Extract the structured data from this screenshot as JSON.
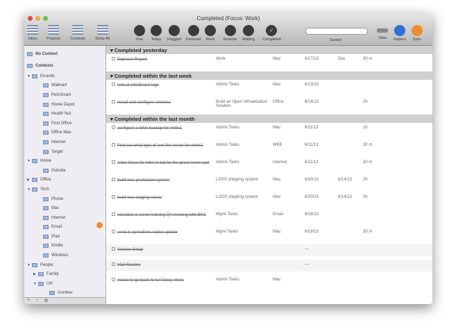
{
  "window": {
    "title": "Completed (Focus: Work)"
  },
  "toolbar": {
    "left": [
      "Inbox",
      "Projects",
      "Contexts",
      "Show All"
    ],
    "perspectives": [
      "Due",
      "Today",
      "Flagged",
      "Forecast",
      "Work",
      "Errands",
      "Waiting",
      "Completed"
    ],
    "search_label": "Search",
    "right": [
      "View",
      "Inspect",
      "Sync"
    ]
  },
  "sidebar": {
    "top": [
      "No Context",
      "Contexts"
    ],
    "items": [
      {
        "label": "Errands",
        "lvl": 0,
        "tri": "▼"
      },
      {
        "label": "Walmart",
        "lvl": 1
      },
      {
        "label": "PetsSmart",
        "lvl": 1
      },
      {
        "label": "Home Depot",
        "lvl": 1
      },
      {
        "label": "Health Nut",
        "lvl": 1
      },
      {
        "label": "Post Office",
        "lvl": 1
      },
      {
        "label": "Office Max",
        "lvl": 1
      },
      {
        "label": "Internet",
        "lvl": 1
      },
      {
        "label": "Target",
        "lvl": 1
      },
      {
        "label": "Home",
        "lvl": 0,
        "tri": "▼"
      },
      {
        "label": "Outside",
        "lvl": 1
      },
      {
        "label": "Office",
        "lvl": 0,
        "tri": "▶"
      },
      {
        "label": "Tech",
        "lvl": 0,
        "tri": "▼"
      },
      {
        "label": "Phone",
        "lvl": 1
      },
      {
        "label": "Mac",
        "lvl": 1
      },
      {
        "label": "Internet",
        "lvl": 1
      },
      {
        "label": "Email",
        "lvl": 1
      },
      {
        "label": "iPad",
        "lvl": 1
      },
      {
        "label": "Kindle",
        "lvl": 1
      },
      {
        "label": "Windows",
        "lvl": 1
      },
      {
        "label": "People",
        "lvl": 0,
        "tri": "▼"
      },
      {
        "label": "Family",
        "lvl": 1,
        "tri": "▶"
      },
      {
        "label": "UH",
        "lvl": 1,
        "tri": "▼"
      },
      {
        "label": "Gunther",
        "lvl": 2
      }
    ],
    "footer": [
      "+",
      "−",
      "⚙"
    ]
  },
  "groups": [
    {
      "title": "Completed yesterday",
      "rows": [
        [
          "Expense Report",
          "Work",
          "Mac",
          "6/17/13",
          "Dec",
          "30 m",
          ""
        ]
      ]
    },
    {
      "title": "Completed within the last week",
      "rows": [
        [
          "look at wiki/Errors logs",
          "Admin Tasks",
          "Mac",
          "6/13/13",
          "",
          "",
          ""
        ],
        [
          "install and configure vmwrise",
          "Build an Open Virtualization Solution",
          "Office",
          "6/14/13",
          "",
          "2h",
          ""
        ]
      ]
    },
    {
      "title": "Completed within the last month",
      "rows": [
        [
          "configure a drive backup for vmhs1",
          "Admin Tasks",
          "Mac",
          "6/11/13",
          "",
          "1h",
          ""
        ],
        [
          "Find out what type of ram the needs for vmhs1",
          "Admin Tasks",
          "WKE",
          "6/11/13",
          "",
          "30 m",
          ""
        ],
        [
          "order these for mike in bid for the press room rack",
          "Admin Tasks",
          "Internet",
          "6/11/13",
          "",
          "30 m",
          ""
        ],
        [
          "build loss production system",
          "LOSS shipping system",
          "Mac",
          "6/20/13",
          "6/14/13",
          "2h",
          ""
        ],
        [
          "build loss staging server",
          "LOSS shipping system",
          "Mac",
          "6/20/13",
          "6/14/13",
          "2h",
          ""
        ],
        [
          "schedule a server training QA meeting with BKC",
          "Mgmt Tasks",
          "Email",
          "6/18/13",
          "",
          "",
          ""
        ],
        [
          "send in operations status update",
          "Mgmt Tasks",
          "Mac",
          "6/18/13",
          "",
          "30 m",
          ""
        ]
      ]
    },
    {
      "title": "",
      "alt": true,
      "rows": [
        [
          "Version Setup",
          "",
          "",
          "—",
          "",
          "",
          ""
        ]
      ]
    },
    {
      "title": "",
      "alt": true,
      "rows": [
        [
          "Mail Restore",
          "",
          "",
          "—",
          "",
          "",
          ""
        ]
      ]
    },
    {
      "title": "",
      "rows": [
        [
          "macro to go back to run fancy views",
          "Admin Tasks",
          "Mac",
          "",
          "",
          "",
          ""
        ]
      ]
    }
  ]
}
